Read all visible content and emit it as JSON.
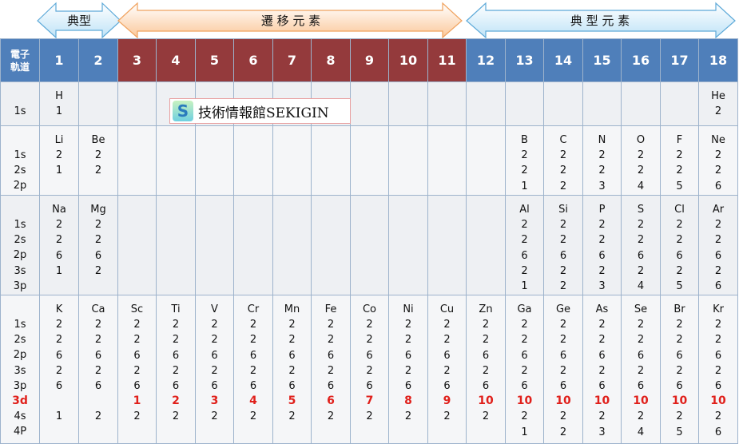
{
  "banner": {
    "typical_left": "典型",
    "transition": "遷 移 元 素",
    "typical_right": "典 型 元 素"
  },
  "header": {
    "orbital_label_line1": "電子",
    "orbital_label_line2": "軌道",
    "groups": [
      "1",
      "2",
      "3",
      "4",
      "5",
      "6",
      "7",
      "8",
      "9",
      "10",
      "11",
      "12",
      "13",
      "14",
      "15",
      "16",
      "17",
      "18"
    ],
    "transition_groups": [
      "3",
      "4",
      "5",
      "6",
      "7",
      "8",
      "9",
      "10",
      "11"
    ]
  },
  "watermark": {
    "icon_letter": "S",
    "text": "技術情報館SEKIGIN"
  },
  "rows": [
    {
      "orbitals": [
        "1s"
      ],
      "cells": {
        "1": [
          "H",
          "1"
        ],
        "18": [
          "He",
          "2"
        ]
      }
    },
    {
      "orbitals": [
        "1s",
        "2s",
        "2p"
      ],
      "cells": {
        "1": [
          "Li",
          "2",
          "1"
        ],
        "2": [
          "Be",
          "2",
          "2"
        ],
        "13": [
          "B",
          "2",
          "2",
          "1"
        ],
        "14": [
          "C",
          "2",
          "2",
          "2"
        ],
        "15": [
          "N",
          "2",
          "2",
          "3"
        ],
        "16": [
          "O",
          "2",
          "2",
          "4"
        ],
        "17": [
          "F",
          "2",
          "2",
          "5"
        ],
        "18": [
          "Ne",
          "2",
          "2",
          "6"
        ]
      }
    },
    {
      "orbitals": [
        "1s",
        "2s",
        "2p",
        "3s",
        "3p"
      ],
      "cells": {
        "1": [
          "Na",
          "2",
          "2",
          "6",
          "1"
        ],
        "2": [
          "Mg",
          "2",
          "2",
          "6",
          "2"
        ],
        "13": [
          "Al",
          "2",
          "2",
          "6",
          "2",
          "1"
        ],
        "14": [
          "Si",
          "2",
          "2",
          "6",
          "2",
          "2"
        ],
        "15": [
          "P",
          "2",
          "2",
          "6",
          "2",
          "3"
        ],
        "16": [
          "S",
          "2",
          "2",
          "6",
          "2",
          "4"
        ],
        "17": [
          "Cl",
          "2",
          "2",
          "6",
          "2",
          "5"
        ],
        "18": [
          "Ar",
          "2",
          "2",
          "6",
          "2",
          "6"
        ]
      }
    },
    {
      "orbitals": [
        "1s",
        "2s",
        "2p",
        "3s",
        "3p",
        "3d",
        "4s",
        "4P"
      ],
      "highlight_orbital": "3d",
      "cells": {
        "1": [
          "K",
          "2",
          "2",
          "6",
          "2",
          "6",
          "",
          "1"
        ],
        "2": [
          "Ca",
          "2",
          "2",
          "6",
          "2",
          "6",
          "",
          "2"
        ],
        "3": [
          "Sc",
          "2",
          "2",
          "6",
          "2",
          "6",
          "1",
          "2"
        ],
        "4": [
          "Ti",
          "2",
          "2",
          "6",
          "2",
          "6",
          "2",
          "2"
        ],
        "5": [
          "V",
          "2",
          "2",
          "6",
          "2",
          "6",
          "3",
          "2"
        ],
        "6": [
          "Cr",
          "2",
          "2",
          "6",
          "2",
          "6",
          "4",
          "2"
        ],
        "7": [
          "Mn",
          "2",
          "2",
          "6",
          "2",
          "6",
          "5",
          "2"
        ],
        "8": [
          "Fe",
          "2",
          "2",
          "6",
          "2",
          "6",
          "6",
          "2"
        ],
        "9": [
          "Co",
          "2",
          "2",
          "6",
          "2",
          "6",
          "7",
          "2"
        ],
        "10": [
          "Ni",
          "2",
          "2",
          "6",
          "2",
          "6",
          "8",
          "2"
        ],
        "11": [
          "Cu",
          "2",
          "2",
          "6",
          "2",
          "6",
          "9",
          "2"
        ],
        "12": [
          "Zn",
          "2",
          "2",
          "6",
          "2",
          "6",
          "10",
          "2"
        ],
        "13": [
          "Ga",
          "2",
          "2",
          "6",
          "2",
          "6",
          "10",
          "2",
          "1"
        ],
        "14": [
          "Ge",
          "2",
          "2",
          "6",
          "2",
          "6",
          "10",
          "2",
          "2"
        ],
        "15": [
          "As",
          "2",
          "2",
          "6",
          "2",
          "6",
          "10",
          "2",
          "3"
        ],
        "16": [
          "Se",
          "2",
          "2",
          "6",
          "2",
          "6",
          "10",
          "2",
          "4"
        ],
        "17": [
          "Br",
          "2",
          "2",
          "6",
          "2",
          "6",
          "10",
          "2",
          "5"
        ],
        "18": [
          "Kr",
          "2",
          "2",
          "6",
          "2",
          "6",
          "10",
          "2",
          "6"
        ]
      }
    }
  ],
  "colors": {
    "header_blue": "#4f7fba",
    "header_red": "#943a3c",
    "arrow_blue_fill": "#d7eefb",
    "arrow_orange_fill": "#fde0c4",
    "highlight_red": "#e0201b"
  }
}
